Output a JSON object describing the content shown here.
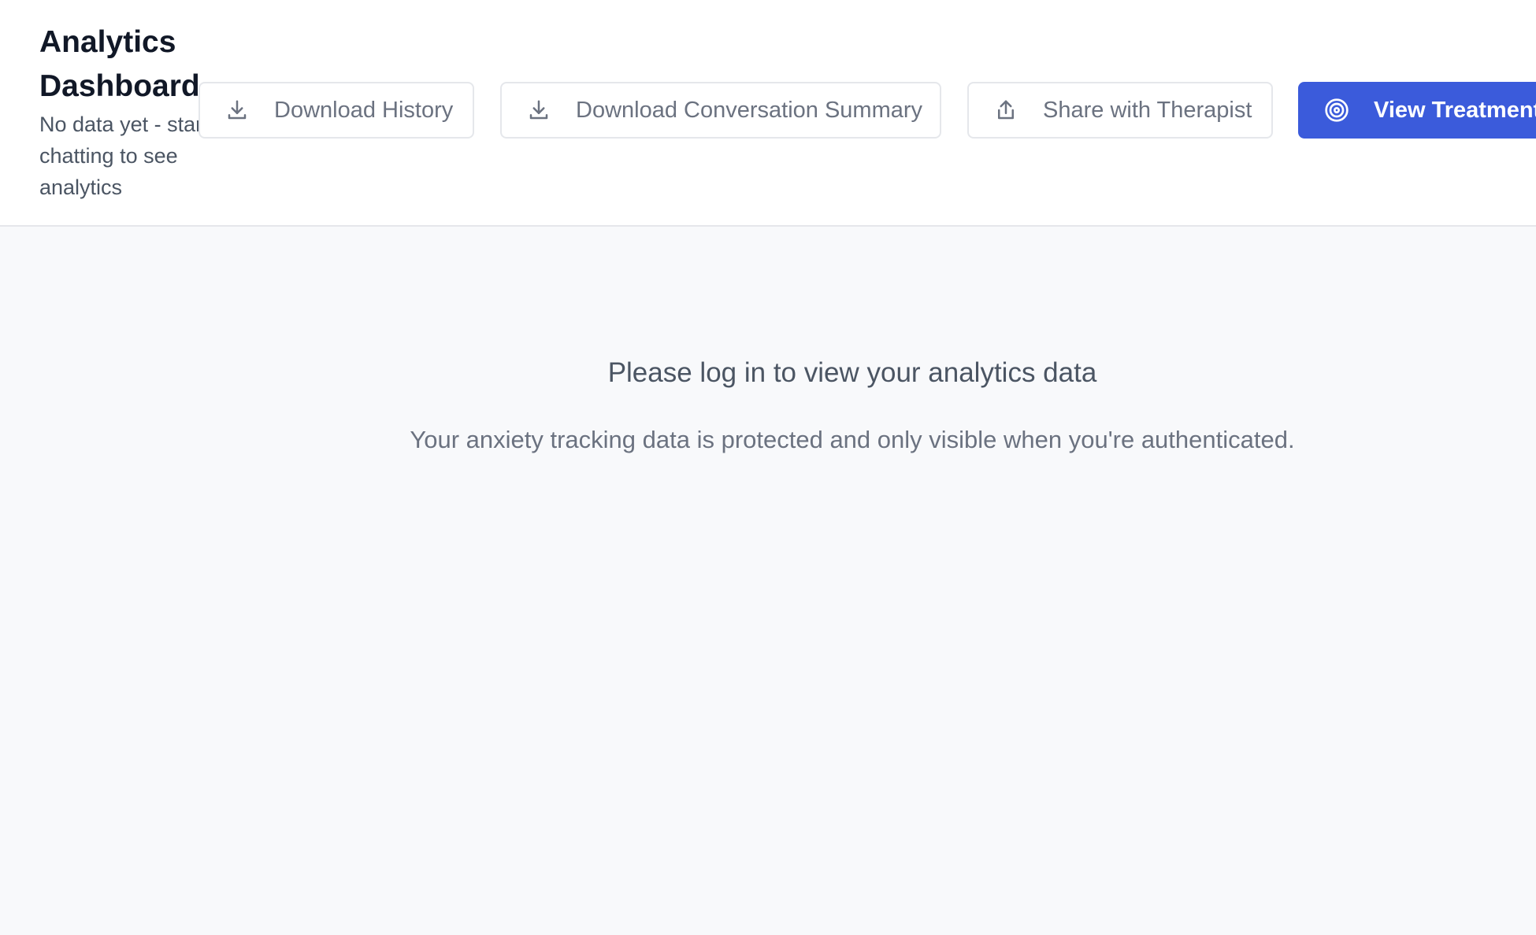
{
  "header": {
    "title": "Analytics Dashboard",
    "subtitle": "No data yet - start chatting to see analytics"
  },
  "toolbar": {
    "download_history": {
      "label": "Download History",
      "icon": "download-icon"
    },
    "download_summary": {
      "label": "Download Conversation Summary",
      "icon": "download-icon"
    },
    "share_therapist": {
      "label": "Share with Therapist",
      "icon": "share-icon"
    },
    "view_treatment": {
      "label": "View Treatment",
      "icon": "target-icon"
    }
  },
  "main": {
    "empty_title": "Please log in to view your analytics data",
    "empty_message": "Your anxiety tracking data is protected and only visible when you're authenticated."
  },
  "colors": {
    "primary": "#3b5bdb",
    "header_bg": "#ffffff",
    "page_bg": "#f8f9fb",
    "title_text": "#111827",
    "muted_text": "#6b7280"
  }
}
